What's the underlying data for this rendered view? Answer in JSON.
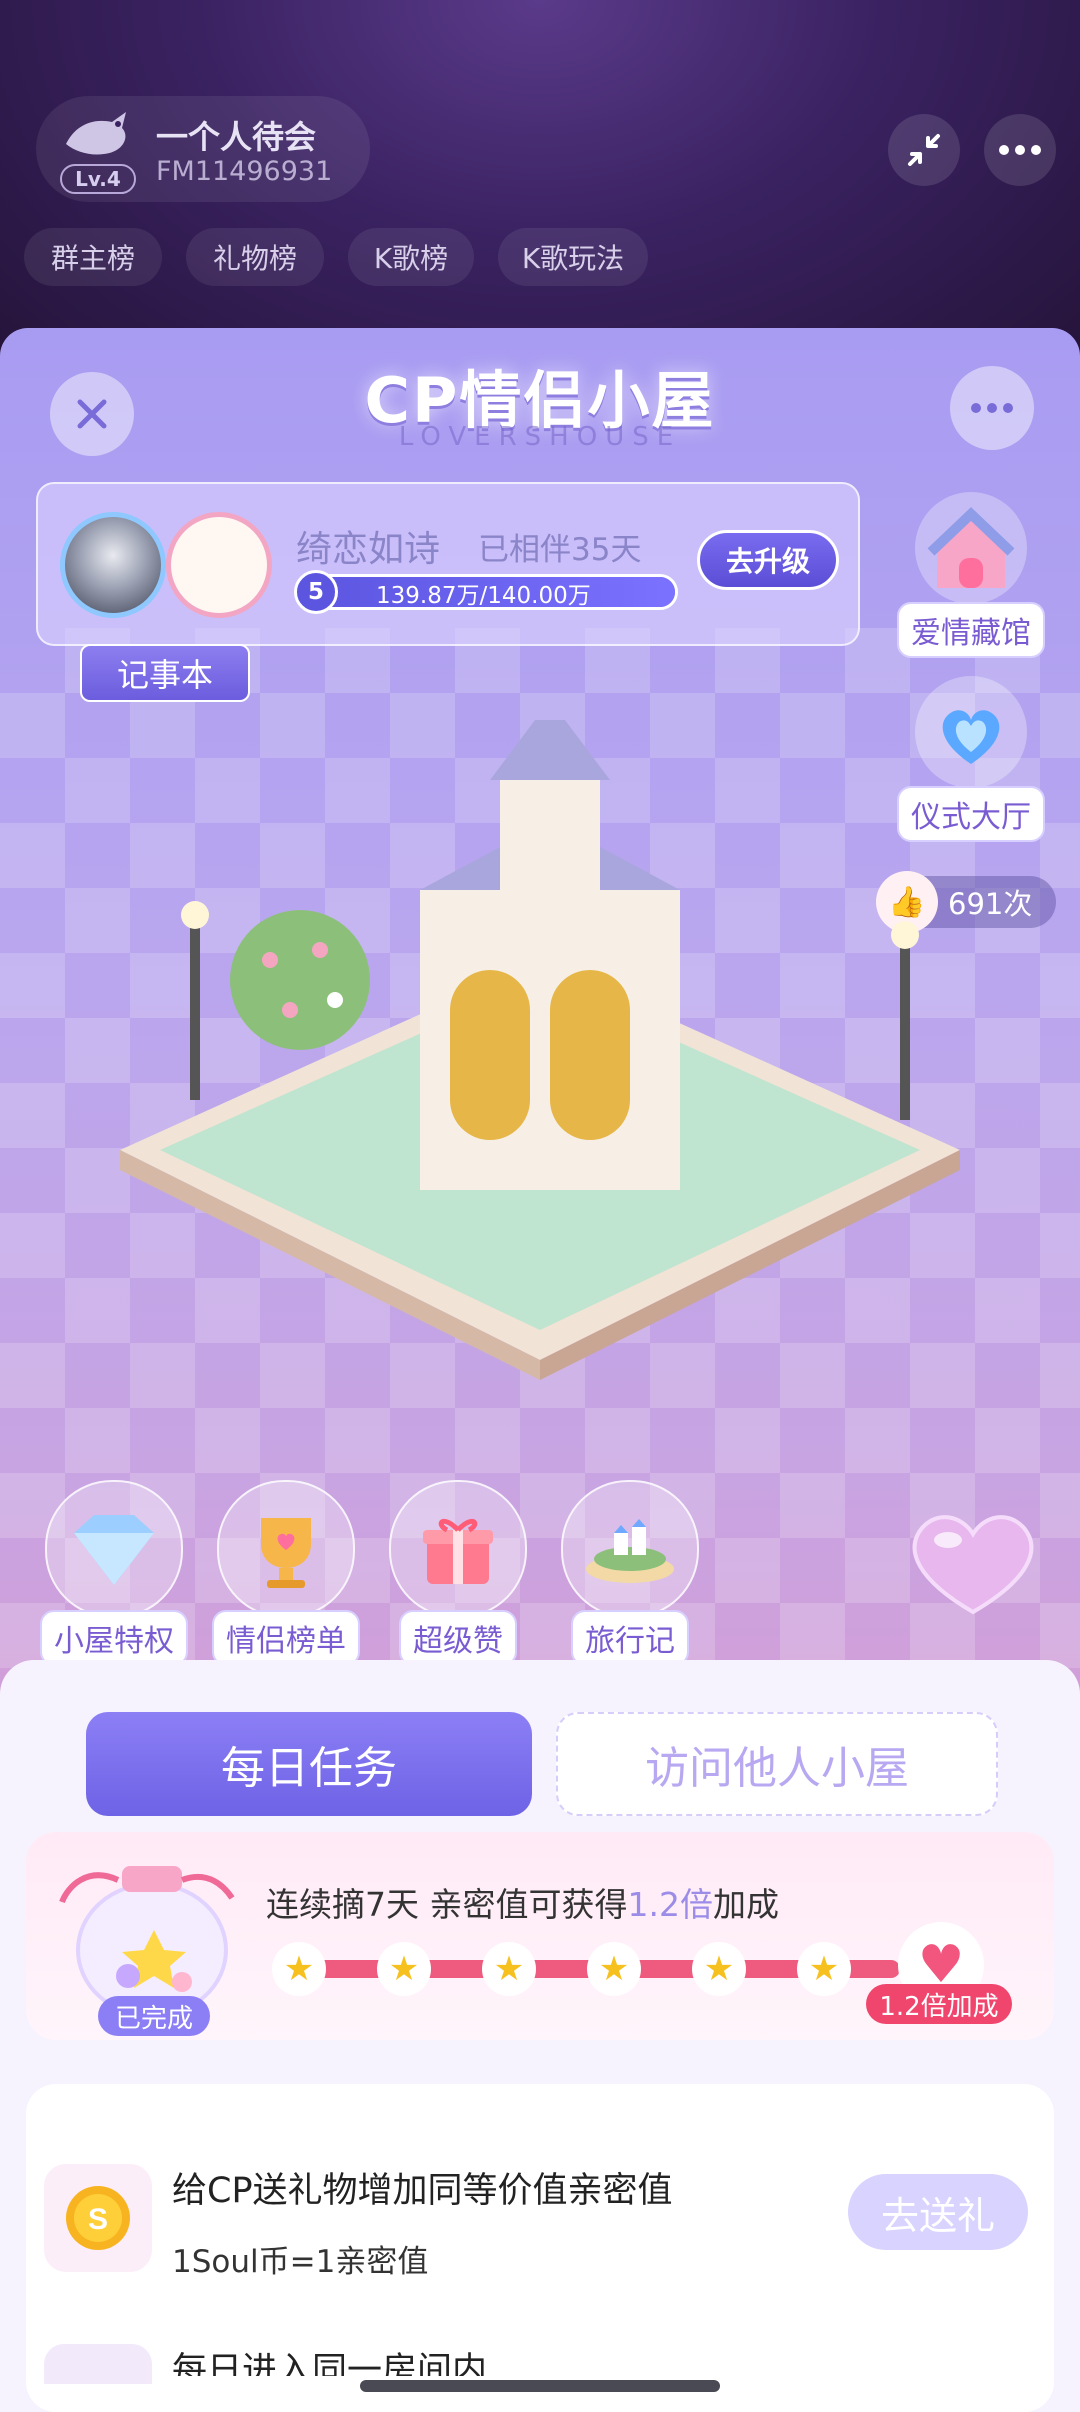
{
  "room": {
    "name": "一个人待会",
    "id": "FM11496931",
    "level": "Lv.4"
  },
  "rank_tabs": [
    "群主榜",
    "礼物榜",
    "K歌榜",
    "K歌玩法"
  ],
  "panel": {
    "title": "CP情侣小屋",
    "subtitle": "LOVERSHOUSE"
  },
  "cp": {
    "partner_name": "绮恋如诗",
    "together": "已相伴35天",
    "level": "5",
    "progress_text": "139.87万/140.00万",
    "progress_fraction": 0.999,
    "upgrade_label": "去升级",
    "notebook_label": "记事本"
  },
  "side": {
    "love_museum": "爱情藏馆",
    "ceremony_hall": "仪式大厅",
    "likes": "691次"
  },
  "features": [
    "小屋特权",
    "情侣榜单",
    "超级赞",
    "旅行记"
  ],
  "tabs": {
    "daily": "每日任务",
    "visit": "访问他人小屋"
  },
  "streak": {
    "text_before": "连续摘7天 亲密值可获得",
    "multiplier": "1.2倍",
    "text_after": "加成",
    "done_label": "已完成",
    "bonus_label": "1.2倍加成",
    "stars_completed": 6
  },
  "task": {
    "title": "给CP送礼物增加同等价值亲密值",
    "subtitle": "1Soul币=1亲密值",
    "button": "去送礼",
    "next_title": "每日进入同一房间内"
  },
  "colors": {
    "accent": "#7b6ef0",
    "pink": "#f0466e",
    "panel_top": "#a89cf2",
    "panel_bottom": "#e8a9d2"
  }
}
